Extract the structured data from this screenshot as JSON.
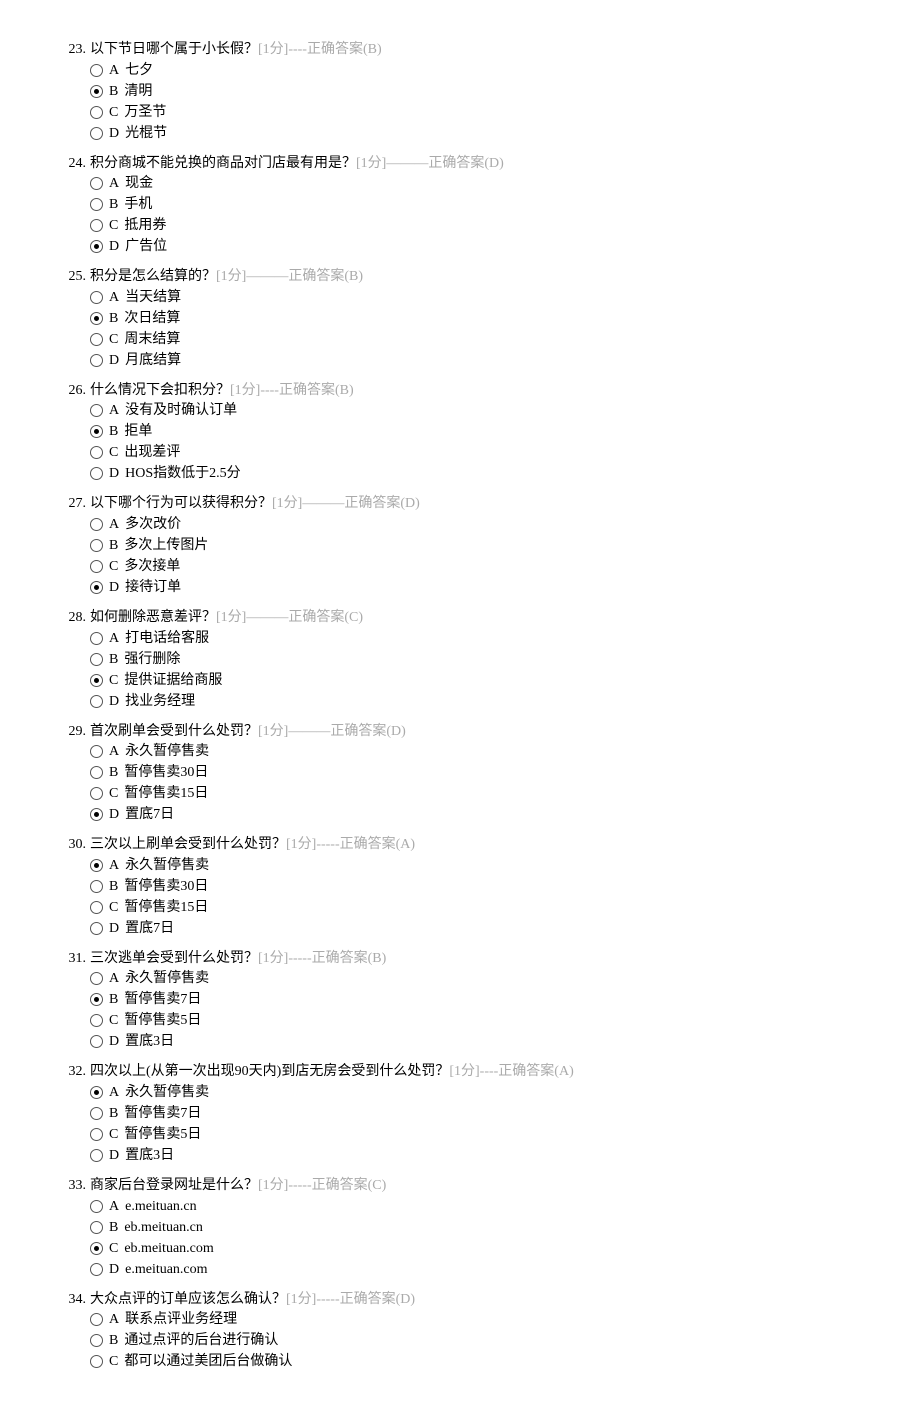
{
  "questions": [
    {
      "num": "23.",
      "text": "以下节日哪个属于小长假？",
      "meta": "[1分]----正确答案(B)",
      "options": [
        {
          "letter": "A",
          "label": "七夕",
          "selected": false
        },
        {
          "letter": "B",
          "label": "清明",
          "selected": true
        },
        {
          "letter": "C",
          "label": "万圣节",
          "selected": false
        },
        {
          "letter": "D",
          "label": "光棍节",
          "selected": false
        }
      ]
    },
    {
      "num": "24.",
      "text": "积分商城不能兑换的商品对门店最有用是？",
      "meta": "[1分]———正确答案(D)",
      "options": [
        {
          "letter": "A",
          "label": "现金",
          "selected": false
        },
        {
          "letter": "B",
          "label": "手机",
          "selected": false
        },
        {
          "letter": "C",
          "label": "抵用券",
          "selected": false
        },
        {
          "letter": "D",
          "label": "广告位",
          "selected": true
        }
      ]
    },
    {
      "num": "25.",
      "text": "积分是怎么结算的？",
      "meta": "[1分]———正确答案(B)",
      "options": [
        {
          "letter": "A",
          "label": "当天结算",
          "selected": false
        },
        {
          "letter": "B",
          "label": "次日结算",
          "selected": true
        },
        {
          "letter": "C",
          "label": "周末结算",
          "selected": false
        },
        {
          "letter": "D",
          "label": "月底结算",
          "selected": false
        }
      ]
    },
    {
      "num": "26.",
      "text": "什么情况下会扣积分？",
      "meta": "[1分]----正确答案(B)",
      "options": [
        {
          "letter": "A",
          "label": "没有及时确认订单",
          "selected": false
        },
        {
          "letter": "B",
          "label": "拒单",
          "selected": true
        },
        {
          "letter": "C",
          "label": "出现差评",
          "selected": false
        },
        {
          "letter": "D",
          "label": "HOS指数低于2.5分",
          "selected": false
        }
      ]
    },
    {
      "num": "27.",
      "text": " 以下哪个行为可以获得积分？",
      "meta": "[1分]———正确答案(D)",
      "options": [
        {
          "letter": "A",
          "label": "多次改价",
          "selected": false
        },
        {
          "letter": "B",
          "label": "多次上传图片",
          "selected": false
        },
        {
          "letter": "C",
          "label": "多次接单",
          "selected": false
        },
        {
          "letter": "D",
          "label": "接待订单",
          "selected": true
        }
      ]
    },
    {
      "num": "28.",
      "text": "如何删除恶意差评？",
      "meta": "[1分]———正确答案(C)",
      "options": [
        {
          "letter": "A",
          "label": "打电话给客服",
          "selected": false
        },
        {
          "letter": "B",
          "label": "强行删除",
          "selected": false
        },
        {
          "letter": "C",
          "label": "提供证据给商服",
          "selected": true
        },
        {
          "letter": "D",
          "label": "找业务经理",
          "selected": false
        }
      ]
    },
    {
      "num": "29.",
      "text": "首次刷单会受到什么处罚？",
      "meta": "[1分]———正确答案(D)",
      "options": [
        {
          "letter": "A",
          "label": "永久暂停售卖",
          "selected": false
        },
        {
          "letter": "B",
          "label": "暂停售卖30日",
          "selected": false
        },
        {
          "letter": "C",
          "label": "暂停售卖15日",
          "selected": false
        },
        {
          "letter": "D",
          "label": "置底7日",
          "selected": true
        }
      ]
    },
    {
      "num": "30.",
      "text": "三次以上刷单会受到什么处罚？",
      "meta": "[1分]-----正确答案(A)",
      "options": [
        {
          "letter": "A",
          "label": "永久暂停售卖",
          "selected": true
        },
        {
          "letter": "B",
          "label": "暂停售卖30日",
          "selected": false
        },
        {
          "letter": "C",
          "label": "暂停售卖15日",
          "selected": false
        },
        {
          "letter": "D",
          "label": "置底7日",
          "selected": false
        }
      ]
    },
    {
      "num": "31.",
      "text": "三次逃单会受到什么处罚？",
      "meta": "[1分]-----正确答案(B)",
      "options": [
        {
          "letter": "A",
          "label": "永久暂停售卖",
          "selected": false
        },
        {
          "letter": "B",
          "label": "暂停售卖7日",
          "selected": true
        },
        {
          "letter": "C",
          "label": "暂停售卖5日",
          "selected": false
        },
        {
          "letter": "D",
          "label": "置底3日",
          "selected": false
        }
      ]
    },
    {
      "num": "32.",
      "text": "四次以上(从第一次出现90天内)到店无房会受到什么处罚？",
      "meta": "[1分]----正确答案(A)",
      "options": [
        {
          "letter": "A",
          "label": "永久暂停售卖",
          "selected": true
        },
        {
          "letter": "B",
          "label": "暂停售卖7日",
          "selected": false
        },
        {
          "letter": "C",
          "label": "暂停售卖5日",
          "selected": false
        },
        {
          "letter": "D",
          "label": "置底3日",
          "selected": false
        }
      ]
    },
    {
      "num": "33.",
      "text": "商家后台登录网址是什么？",
      "meta": "[1分]-----正确答案(C)",
      "options": [
        {
          "letter": "A",
          "label": "e.meituan.cn",
          "selected": false
        },
        {
          "letter": "B",
          "label": "eb.meituan.cn",
          "selected": false
        },
        {
          "letter": "C",
          "label": "eb.meituan.com",
          "selected": true
        },
        {
          "letter": "D",
          "label": "e.meituan.com",
          "selected": false
        }
      ]
    },
    {
      "num": "34.",
      "text": "大众点评的订单应该怎么确认？",
      "meta": "[1分]-----正确答案(D)",
      "options": [
        {
          "letter": "A",
          "label": "联系点评业务经理",
          "selected": false
        },
        {
          "letter": "B",
          "label": "通过点评的后台进行确认",
          "selected": false
        },
        {
          "letter": "C",
          "label": "都可以通过美团后台做确认",
          "selected": false
        }
      ]
    }
  ]
}
